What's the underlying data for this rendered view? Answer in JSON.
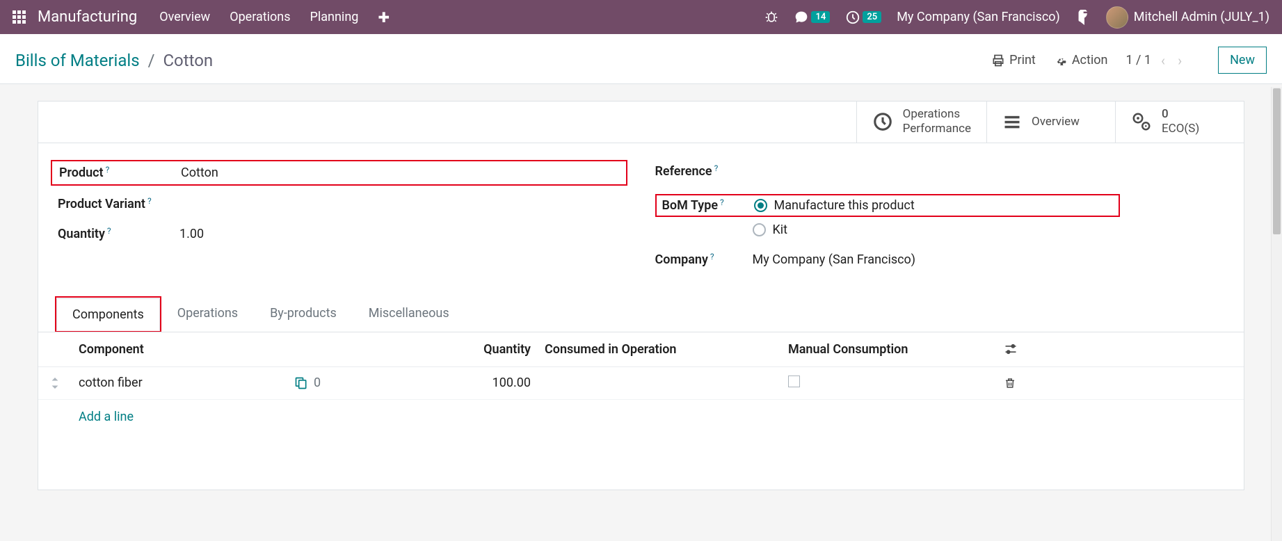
{
  "topnav": {
    "brand": "Manufacturing",
    "items": [
      "Overview",
      "Operations",
      "Planning"
    ],
    "messages_badge": "14",
    "activities_badge": "25",
    "company": "My Company (San Francisco)",
    "user": "Mitchell Admin (JULY_1)"
  },
  "controlbar": {
    "breadcrumb_root": "Bills of Materials",
    "breadcrumb_current": "Cotton",
    "print": "Print",
    "action": "Action",
    "pager": "1 / 1",
    "new": "New"
  },
  "stat": {
    "ops_perf_l1": "Operations",
    "ops_perf_l2": "Performance",
    "overview": "Overview",
    "eco_count": "0",
    "eco_label": "ECO(S)"
  },
  "form": {
    "product_label": "Product",
    "product_val": "Cotton",
    "variant_label": "Product Variant",
    "qty_label": "Quantity",
    "qty_val": "1.00",
    "ref_label": "Reference",
    "bomtype_label": "BoM Type",
    "bomtype_opt1": "Manufacture this product",
    "bomtype_opt2": "Kit",
    "company_label": "Company",
    "company_val": "My Company (San Francisco)"
  },
  "tabs": {
    "components": "Components",
    "operations": "Operations",
    "byproducts": "By-products",
    "misc": "Miscellaneous"
  },
  "table": {
    "hdr_component": "Component",
    "hdr_qty": "Quantity",
    "hdr_consumed": "Consumed in Operation",
    "hdr_manual": "Manual Consumption",
    "row0_name": "cotton fiber",
    "row0_forecast": "0",
    "row0_qty": "100.00",
    "add_line": "Add a line"
  }
}
